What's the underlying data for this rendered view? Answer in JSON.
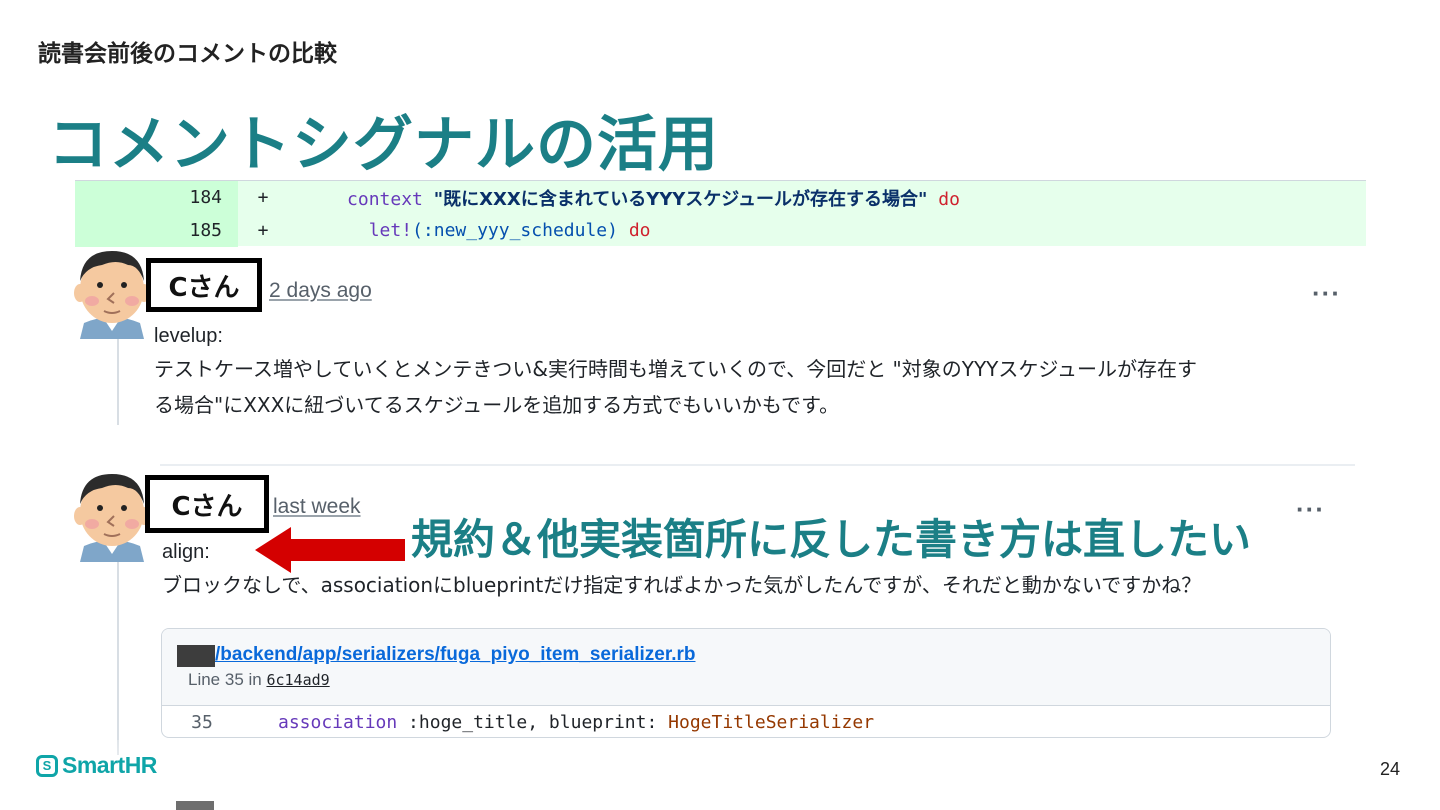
{
  "slide": {
    "subtitle": "読書会前後のコメントの比較",
    "title": "コメントシグナルの活用",
    "page_number": "24"
  },
  "diff": {
    "rows": [
      {
        "line": "184",
        "sign": "+",
        "indent": "      ",
        "keyword": "context",
        "string": "\"既にXXXに含まれているYYYスケジュールが存在する場合\"",
        "tail": "do"
      },
      {
        "line": "185",
        "sign": "+",
        "indent": "        ",
        "keyword": "let!",
        "args": "(:new_yyy_schedule)",
        "tail": "do"
      }
    ]
  },
  "comments": [
    {
      "author": "Cさん",
      "time": "2 days ago",
      "menu": "···",
      "tag": "levelup:",
      "body_line1": "テストケース増やしていくとメンテきつい&実行時間も増えていくので、今回だと \"対象のYYYスケジュールが存在す",
      "body_line2": "る場合\"にXXXに紐づいてるスケジュールを追加する方式でもいいかもです。"
    },
    {
      "author": "Cさん",
      "time": "last week",
      "menu": "···",
      "tag": "align:",
      "body_line1": "ブロックなしで、associationにblueprintだけ指定すればよかった気がしたんですが、それだと動かないですかね？"
    }
  ],
  "annotation": {
    "text": "規約＆他実装箇所に反した書き方は直したい",
    "color": "#1b7f86",
    "arrow_color": "#d40000"
  },
  "code_reference": {
    "path": "/backend/app/serializers/fuga_piyo_item_serializer.rb",
    "line_prefix": "Line 35 in",
    "sha": "6c14ad9",
    "line_number": "35",
    "code_keyword": "association",
    "code_middle": " :hoge_title, blueprint: ",
    "code_class": "HogeTitleSerializer"
  },
  "footer": {
    "logo_text": "SmartHR",
    "logo_color": "#0fa5a8"
  }
}
